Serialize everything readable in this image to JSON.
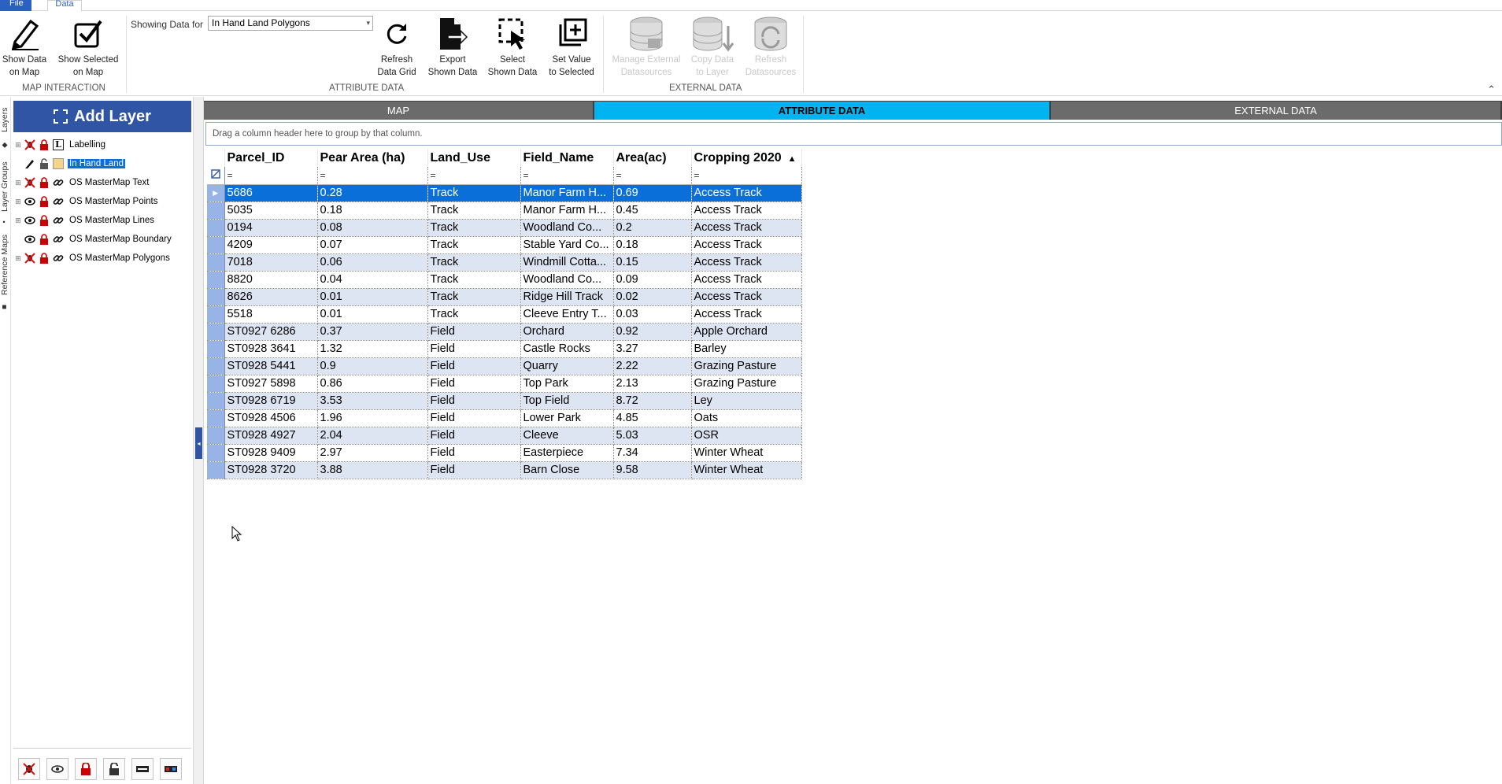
{
  "menu": {
    "file": "File",
    "data": "Data"
  },
  "ribbon": {
    "show_data_on_map": "Show Data\non Map",
    "show_selected_on_map": "Show Selected\non Map",
    "group_map_interaction": "MAP INTERACTION",
    "showing_label": "Showing Data for",
    "showing_value": "In Hand Land Polygons",
    "refresh_data_grid": "Refresh\nData Grid",
    "export_shown_data": "Export\nShown Data",
    "select_shown_data": "Select\nShown Data",
    "set_value_to_selected": "Set Value\nto Selected",
    "group_attribute_data": "ATTRIBUTE DATA",
    "manage_external": "Manage External\nDatasources",
    "copy_data_to_layer": "Copy Data\nto Layer",
    "refresh_datasources": "Refresh\nDatasources",
    "group_external_data": "EXTERNAL DATA"
  },
  "vtabs": [
    "Layers",
    "Layer Groups",
    "Reference Maps"
  ],
  "layers": {
    "add_layer": "Add Layer",
    "items": [
      {
        "label": "Labelling",
        "expandable": true,
        "visible": false,
        "locked": true,
        "icon": "label-L-icon"
      },
      {
        "label": "In Hand Land",
        "expandable": false,
        "editing": true,
        "locked": true,
        "selected": true,
        "icon": "swatch-icon",
        "swatch": "#f3d48a"
      },
      {
        "label": "OS MasterMap Text",
        "expandable": true,
        "visible": false,
        "locked": true,
        "icon": "link-icon"
      },
      {
        "label": "OS MasterMap Points",
        "expandable": true,
        "visible": true,
        "locked": true,
        "icon": "link-icon"
      },
      {
        "label": "OS MasterMap Lines",
        "expandable": true,
        "visible": true,
        "locked": true,
        "icon": "link-icon"
      },
      {
        "label": "OS MasterMap Boundary",
        "expandable": false,
        "visible": true,
        "locked": true,
        "icon": "link-icon"
      },
      {
        "label": "OS MasterMap Polygons",
        "expandable": true,
        "visible": false,
        "locked": true,
        "icon": "link-icon"
      }
    ]
  },
  "tabs": {
    "map": "MAP",
    "attribute": "ATTRIBUTE DATA",
    "external": "EXTERNAL DATA"
  },
  "grid": {
    "group_hint": "Drag a column header here to group by that column.",
    "columns": [
      "Parcel_ID",
      "Pear Area (ha)",
      "Land_Use",
      "Field_Name",
      "Area(ac)",
      "Cropping 2020"
    ],
    "filter_symbol": "=",
    "rows": [
      [
        "5686",
        "0.28",
        "Track",
        "Manor Farm H...",
        "0.69",
        "Access Track"
      ],
      [
        "5035",
        "0.18",
        "Track",
        "Manor Farm H...",
        "0.45",
        "Access Track"
      ],
      [
        "0194",
        "0.08",
        "Track",
        "Woodland Co...",
        "0.2",
        "Access Track"
      ],
      [
        "4209",
        "0.07",
        "Track",
        "Stable Yard Co...",
        "0.18",
        "Access Track"
      ],
      [
        "7018",
        "0.06",
        "Track",
        "Windmill Cotta...",
        "0.15",
        "Access Track"
      ],
      [
        "8820",
        "0.04",
        "Track",
        "Woodland Co...",
        "0.09",
        "Access Track"
      ],
      [
        "8626",
        "0.01",
        "Track",
        "Ridge Hill Track",
        "0.02",
        "Access Track"
      ],
      [
        "5518",
        "0.01",
        "Track",
        "Cleeve Entry T...",
        "0.03",
        "Access Track"
      ],
      [
        "ST0927 6286",
        "0.37",
        "Field",
        "Orchard",
        "0.92",
        "Apple Orchard"
      ],
      [
        "ST0928 3641",
        "1.32",
        "Field",
        "Castle Rocks",
        "3.27",
        "Barley"
      ],
      [
        "ST0928 5441",
        "0.9",
        "Field",
        "Quarry",
        "2.22",
        "Grazing Pasture"
      ],
      [
        "ST0927 5898",
        "0.86",
        "Field",
        "Top Park",
        "2.13",
        "Grazing Pasture"
      ],
      [
        "ST0928 6719",
        "3.53",
        "Field",
        "Top Field",
        "8.72",
        "Ley"
      ],
      [
        "ST0928 4506",
        "1.96",
        "Field",
        "Lower Park",
        "4.85",
        "Oats"
      ],
      [
        "ST0928 4927",
        "2.04",
        "Field",
        "Cleeve",
        "5.03",
        "OSR"
      ],
      [
        "ST0928 9409",
        "2.97",
        "Field",
        "Easterpiece",
        "7.34",
        "Winter Wheat"
      ],
      [
        "ST0928 3720",
        "3.88",
        "Field",
        "Barn Close",
        "9.58",
        "Winter Wheat"
      ]
    ]
  }
}
